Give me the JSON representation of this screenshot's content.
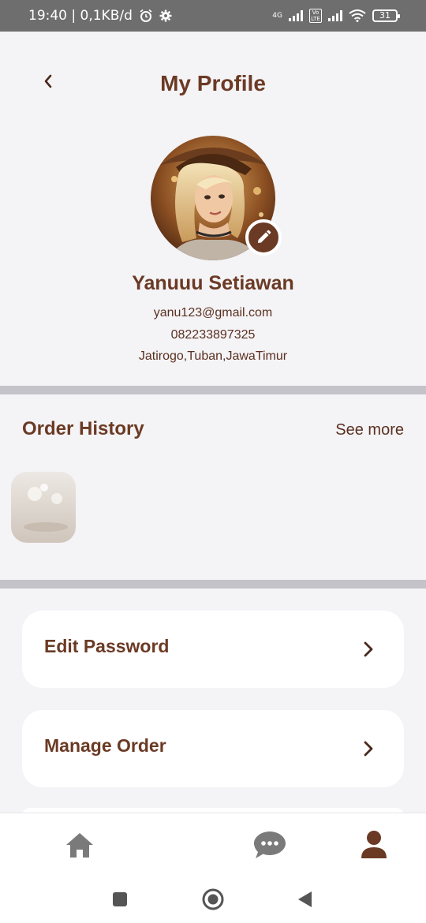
{
  "status_bar": {
    "time_speed": "19:40 | 0,1KB/d",
    "network_4g": "4G",
    "volte": "Vo LTE",
    "battery": "31"
  },
  "header": {
    "title": "My Profile"
  },
  "profile": {
    "name": "Yanuuu Setiawan",
    "email": "yanu123@gmail.com",
    "phone": "082233897325",
    "address": "Jatirogo,Tuban,JawaTimur"
  },
  "order_history": {
    "title": "Order History",
    "see_more": "See more"
  },
  "menu": [
    {
      "label": "Edit Password"
    },
    {
      "label": "Manage Order"
    }
  ],
  "bottom_nav": {
    "items": [
      {
        "icon": "home-icon"
      },
      {
        "icon": "chat-icon"
      },
      {
        "icon": "profile-icon"
      }
    ]
  },
  "colors": {
    "brand_brown": "#6b3a24",
    "background": "#f4f3f6",
    "divider": "#c4c3ca",
    "nav_icon_gray": "#7a7a7a"
  }
}
